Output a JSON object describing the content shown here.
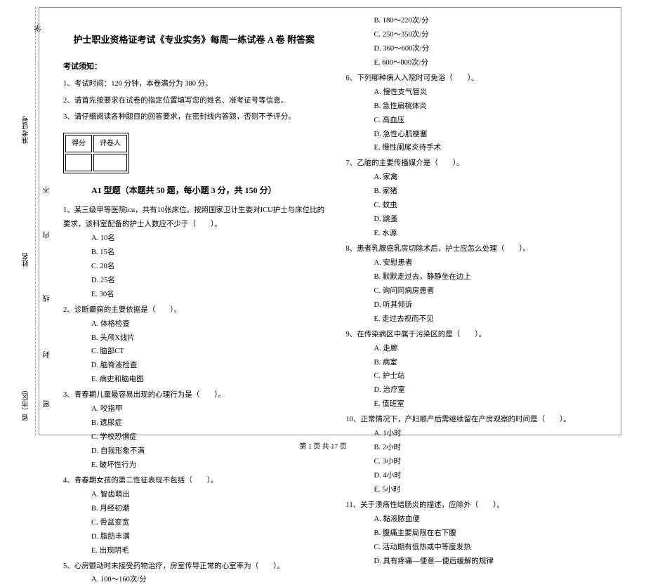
{
  "side": {
    "seal_top": "密",
    "seal_mid": "封",
    "seal_bot": "线",
    "nei": "内",
    "bu": "不",
    "province": "省（市区）",
    "name": "姓名",
    "exam_id": "准考证号",
    "school": "学"
  },
  "title": "护士职业资格证考试《专业实务》每周一练试卷 A 卷  附答案",
  "notice_header": "考试须知：",
  "instructions": {
    "i1": "1、考试时间：120 分钟，本卷满分为 380 分。",
    "i2": "2、请首先按要求在试卷的指定位置填写您的姓名、准考证号等信息。",
    "i3": "3、请仔细阅读各种题目的回答要求，在密封线内答题，否则不予评分。"
  },
  "score_box": {
    "score": "得分",
    "marker": "评卷人"
  },
  "section_a1": "A1 型题（本题共 50 题，每小题 3 分，共 150 分）",
  "q1": {
    "text": "1、某三级甲等医院icu，共有10张床位。按照国家卫计生委对ICU护士与床位比的要求，该科室配备的护士人数应不少于（　　）。",
    "a": "A. 10名",
    "b": "B. 15名",
    "c": "C. 20名",
    "d": "D. 25名",
    "e": "E. 30名"
  },
  "q2": {
    "text": "2、诊断癫痫的主要依据是（　　）。",
    "a": "A. 体格检查",
    "b": "B. 头颅X线片",
    "c": "C. 脑部CT",
    "d": "D. 脑脊液检查",
    "e": "E. 病史和脑电图"
  },
  "q3": {
    "text": "3、青春期儿童最容易出现的心理行为是（　　）。",
    "a": "A. 咬指甲",
    "b": "B. 遗尿症",
    "c": "C. 学校恐惧症",
    "d": "D. 自我形象不满",
    "e": "E. 破坏性行为"
  },
  "q4": {
    "text": "4、青春期女孩的第二性征表现不包括（　　）。",
    "a": "A. 智齿萌出",
    "b": "B. 月经初潮",
    "c": "C. 骨盆变宽",
    "d": "D. 脂肪丰满",
    "e": "E. 出现阴毛"
  },
  "q5": {
    "text": "5、心房颤动时未接受药物治疗，房室传导正常的心室率为（　　）。",
    "a": "A. 100～160次/分"
  },
  "q5_cont": {
    "b": "B. 180～220次/分",
    "c": "C. 250～350次/分",
    "d": "D. 360～600次/分",
    "e": "E. 600～800次/分"
  },
  "q6": {
    "text": "6、下列哪种病人入院时可免浴（　　）。",
    "a": "A. 慢性支气管炎",
    "b": "B. 急性扁桃体炎",
    "c": "C. 高血压",
    "d": "D. 急性心肌梗塞",
    "e": "E. 慢性阑尾炎待手术"
  },
  "q7": {
    "text": "7、乙脑的主要传播媒介是（　　）。",
    "a": "A. 家禽",
    "b": "B. 家猪",
    "c": "C. 蚊虫",
    "d": "D. 跳蚤",
    "e": "E. 水源"
  },
  "q8": {
    "text": "8、患者乳腺癌乳房切除术后，护士应怎么处理（　　）。",
    "a": "A. 安慰患者",
    "b": "B. 默默走过去，静静坐在边上",
    "c": "C. 询问同病房患者",
    "d": "D. 听其倾诉",
    "e": "E. 走过去视而不见"
  },
  "q9": {
    "text": "9、在传染病区中属于污染区的是（　　）。",
    "a": "A. 走廊",
    "b": "B. 病室",
    "c": "C. 护士站",
    "d": "D. 治疗室",
    "e": "E. 值班室"
  },
  "q10": {
    "text": "10、正常情况下，产妇顺产后需继续留在产房观察的时间是（　　）。",
    "a": "A. 1小时",
    "b": "B. 2小时",
    "c": "C. 3小时",
    "d": "D. 4小时",
    "e": "E. 5小时"
  },
  "q11": {
    "text": "11、关于溃疡性结肠炎的描述，应除外（　　）。",
    "a": "A. 黏液脓血便",
    "b": "B. 腹痛主要局限在右下腹",
    "c": "C. 活动期有低热或中等度发热",
    "d": "D. 具有疼痛—便意—便后缓解的规律"
  },
  "footer": "第 1 页 共 17 页"
}
